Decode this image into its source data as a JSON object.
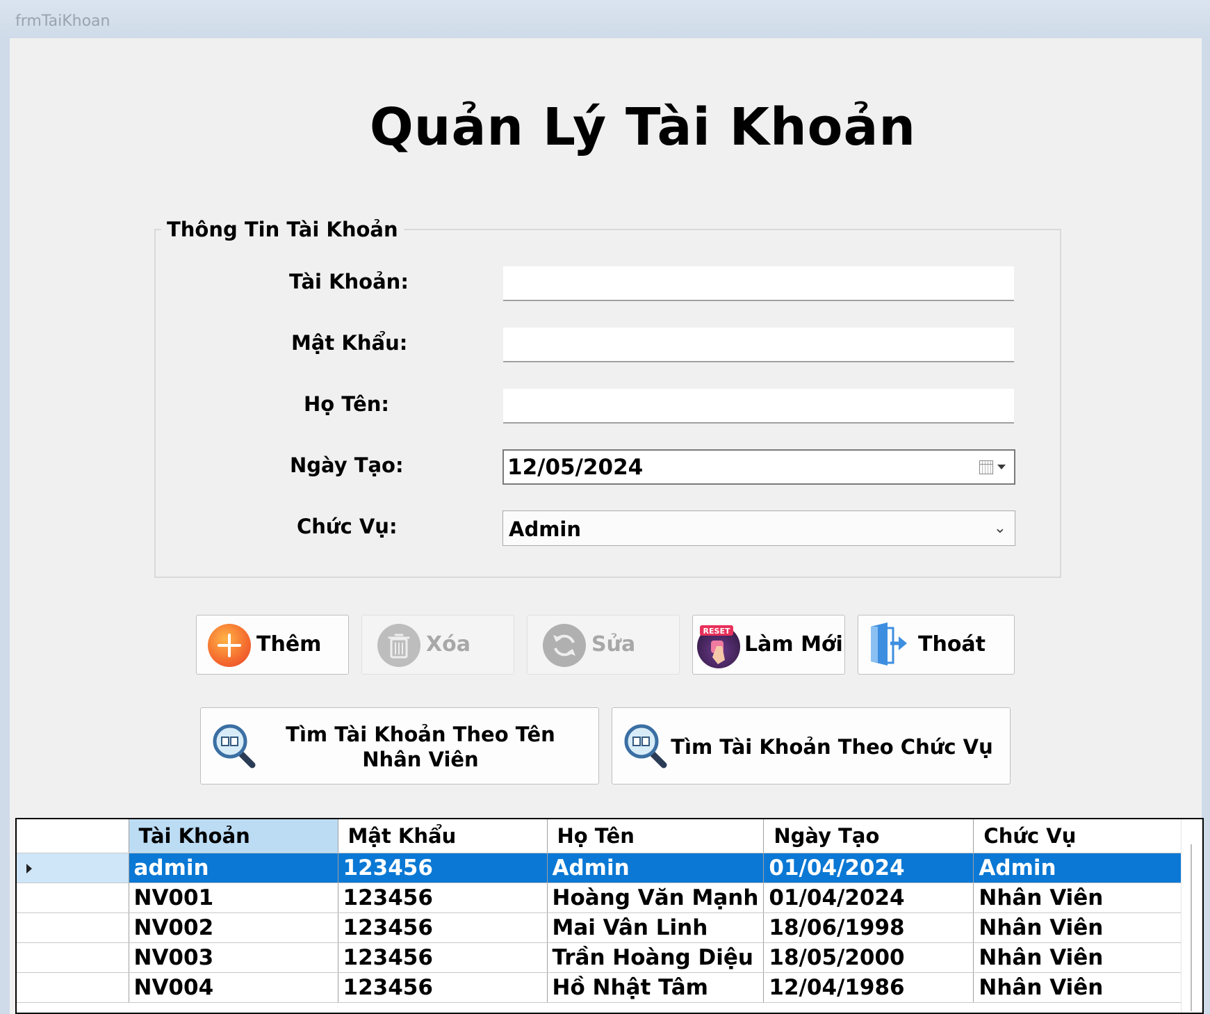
{
  "window": {
    "title": "frmTaiKhoan"
  },
  "header": {
    "title": "Quản Lý Tài Khoản"
  },
  "form": {
    "group_title": "Thông Tin Tài Khoản",
    "labels": {
      "account": "Tài Khoản:",
      "password": "Mật Khẩu:",
      "fullname": "Họ Tên:",
      "created": "Ngày Tạo:",
      "role": "Chức Vụ:"
    },
    "values": {
      "account": "",
      "password": "",
      "fullname": "",
      "created": "12/05/2024",
      "role": "Admin"
    }
  },
  "toolbar": {
    "add": "Thêm",
    "delete": "Xóa",
    "edit": "Sửa",
    "reset": "Làm Mới",
    "reset_badge": "RESET",
    "exit": "Thoát"
  },
  "search": {
    "by_name": "Tìm Tài Khoản Theo Tên Nhân Viên",
    "by_role": "Tìm Tài Khoản Theo Chức Vụ"
  },
  "grid": {
    "columns": [
      "Tài Khoản",
      "Mật Khẩu",
      "Họ Tên",
      "Ngày Tạo",
      "Chức Vụ"
    ],
    "rows": [
      [
        "admin",
        "123456",
        "Admin",
        "01/04/2024",
        "Admin"
      ],
      [
        "NV001",
        "123456",
        "Hoàng Văn Mạnh",
        "01/04/2024",
        "Nhân Viên"
      ],
      [
        "NV002",
        "123456",
        "Mai Vân Linh",
        "18/06/1998",
        "Nhân Viên"
      ],
      [
        "NV003",
        "123456",
        "Trần Hoàng Diệu",
        "18/05/2000",
        "Nhân Viên"
      ],
      [
        "NV004",
        "123456",
        "Hồ Nhật Tâm",
        "12/04/1986",
        "Nhân Viên"
      ]
    ]
  },
  "colors": {
    "selection": "#0a78d4",
    "header_active": "#bcdcf4",
    "add_icon": "#f46a2e",
    "exit_icon": "#3d8ee0"
  }
}
